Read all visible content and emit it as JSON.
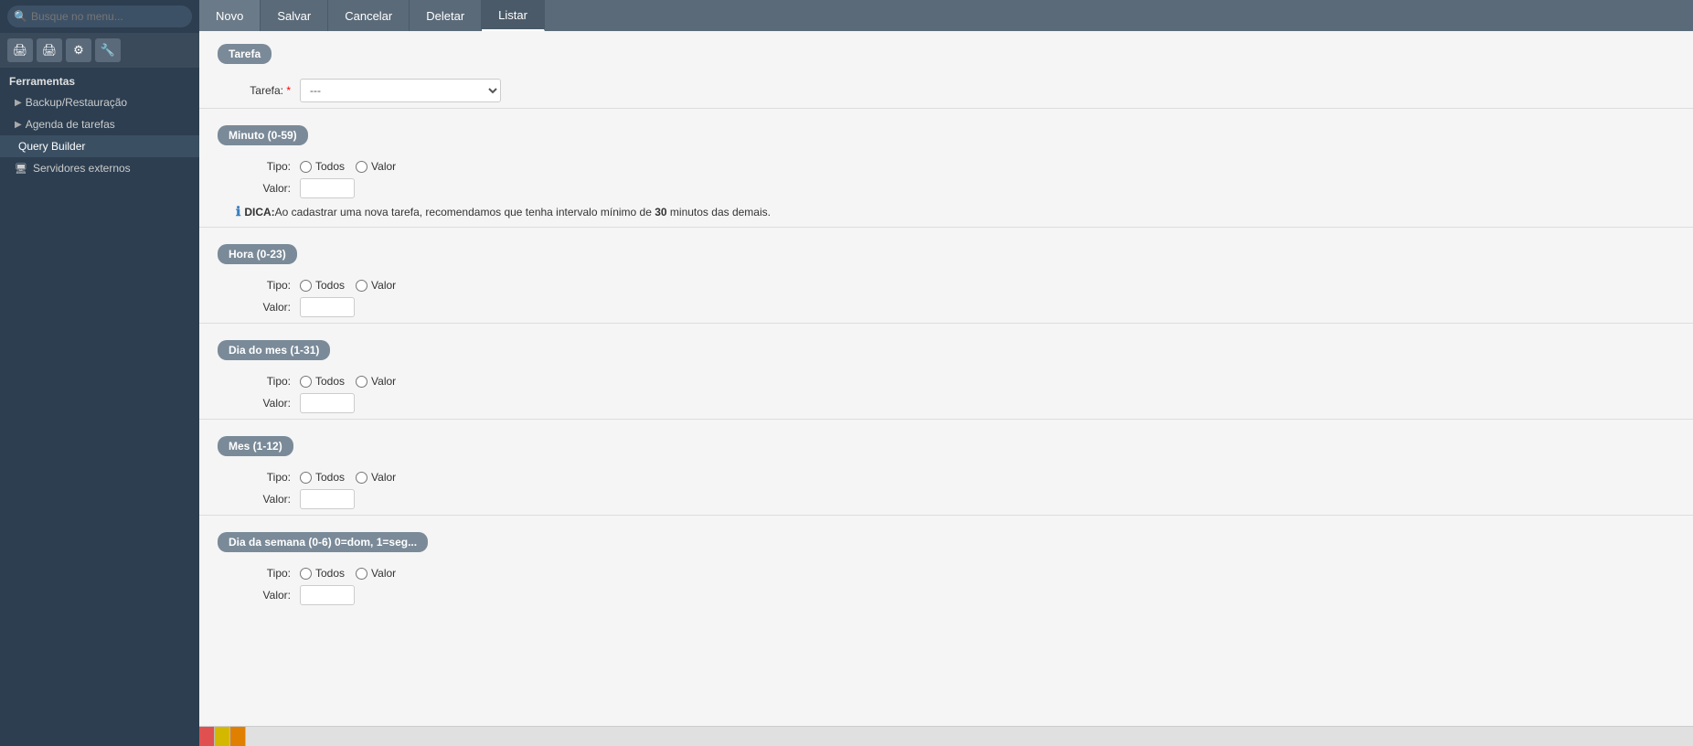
{
  "sidebar": {
    "search_placeholder": "Busque no menu...",
    "section_title": "Ferramentas",
    "nav_items": [
      {
        "id": "backup",
        "label": "Backup/Restauração",
        "icon": "▶",
        "active": false
      },
      {
        "id": "agenda",
        "label": "Agenda de tarefas",
        "icon": "▶",
        "active": false
      },
      {
        "id": "query",
        "label": "Query Builder",
        "icon": "",
        "active": true
      },
      {
        "id": "servers",
        "label": "Servidores externos",
        "icon": "🖥",
        "active": false
      }
    ],
    "toolbar_icons": [
      "🖨",
      "🖨",
      "⚙",
      "🔧"
    ]
  },
  "topbar": {
    "buttons": [
      {
        "id": "novo",
        "label": "Novo",
        "active": false
      },
      {
        "id": "salvar",
        "label": "Salvar",
        "active": false
      },
      {
        "id": "cancelar",
        "label": "Cancelar",
        "active": false
      },
      {
        "id": "deletar",
        "label": "Deletar",
        "active": false
      },
      {
        "id": "listar",
        "label": "Listar",
        "active": true
      }
    ]
  },
  "form": {
    "tarefa_section": "Tarefa",
    "tarefa_label": "Tarefa:",
    "tarefa_required": "*",
    "tarefa_placeholder": "---",
    "tarefa_options": [
      {
        "value": "",
        "label": "---"
      }
    ],
    "sections": [
      {
        "id": "minuto",
        "title": "Minuto (0-59)",
        "tipo_label": "Tipo:",
        "todos_label": "Todos",
        "valor_label": "Valor",
        "valor_field_label": "Valor:",
        "show_tip": true,
        "tip_prefix": "DICA:",
        "tip_text": "Ao cadastrar uma nova tarefa, recomendamos que tenha intervalo mínimo de ",
        "tip_bold": "30",
        "tip_suffix": " minutos das demais."
      },
      {
        "id": "hora",
        "title": "Hora (0-23)",
        "tipo_label": "Tipo:",
        "todos_label": "Todos",
        "valor_label": "Valor",
        "valor_field_label": "Valor:",
        "show_tip": false
      },
      {
        "id": "dia_mes",
        "title": "Dia do mes (1-31)",
        "tipo_label": "Tipo:",
        "todos_label": "Todos",
        "valor_label": "Valor",
        "valor_field_label": "Valor:",
        "show_tip": false
      },
      {
        "id": "mes",
        "title": "Mes (1-12)",
        "tipo_label": "Tipo:",
        "todos_label": "Todos",
        "valor_label": "Valor",
        "valor_field_label": "Valor:",
        "show_tip": false
      },
      {
        "id": "dia_semana",
        "title": "Dia da semana (0-6) 0=dom, 1=seg...",
        "tipo_label": "Tipo:",
        "todos_label": "Todos",
        "valor_label": "Valor",
        "valor_field_label": "Valor:",
        "show_tip": false
      }
    ]
  },
  "statusbar": {
    "segments": [
      "",
      "",
      ""
    ]
  }
}
